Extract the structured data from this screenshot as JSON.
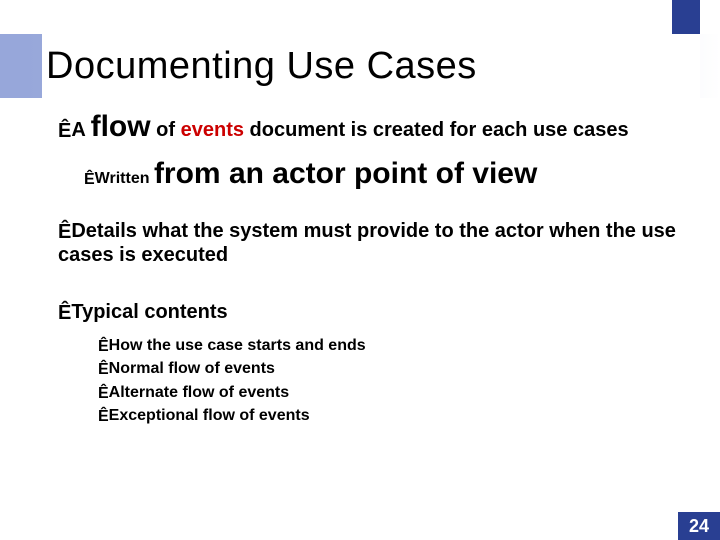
{
  "title": "Documenting Use Cases",
  "bullet1": {
    "prefix": "A ",
    "flow": "flow",
    "mid": " of ",
    "events": "events",
    "rest": " document is created for each use cases"
  },
  "bullet1_sub": {
    "prefix": "Written ",
    "big": "from an actor point of view"
  },
  "bullet2": "Details what the system must provide to the actor when the use cases is executed",
  "bullet3": {
    "heading": "Typical contents",
    "items": [
      "How the use case starts and ends",
      "Normal flow of events",
      "Alternate flow of events",
      "Exceptional flow of events"
    ]
  },
  "page_number": "24",
  "glyphs": {
    "arrow": "Ê"
  }
}
